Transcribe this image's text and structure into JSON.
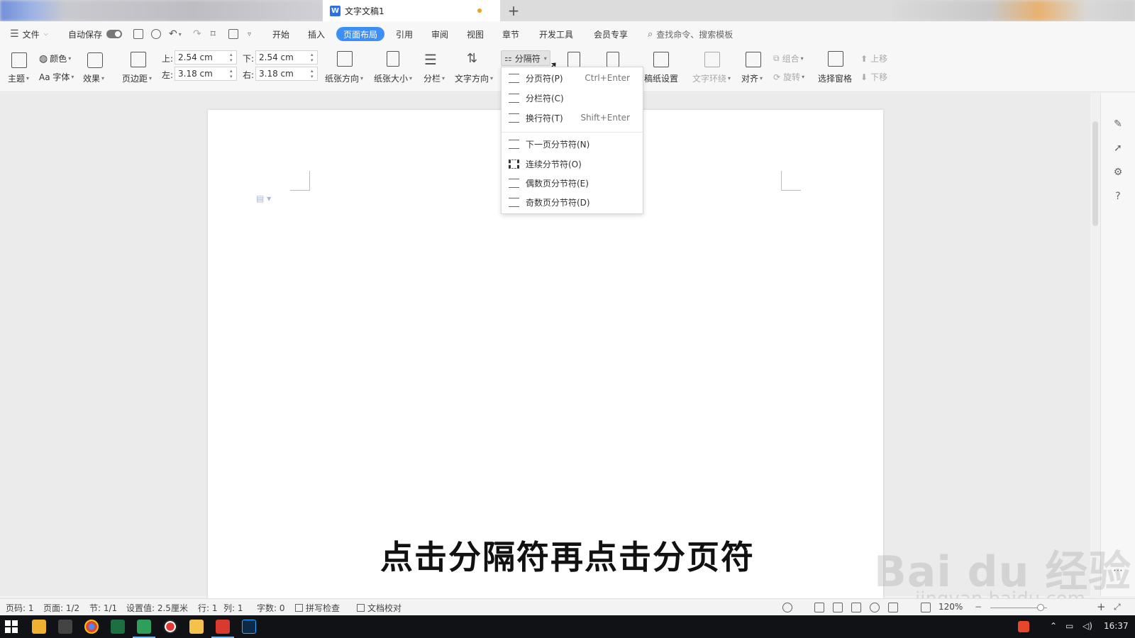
{
  "tab": {
    "title": "文字文稿1",
    "new_tab": "+"
  },
  "menu": {
    "file": "文件",
    "autosave": "自动保存",
    "tabs": [
      "开始",
      "插入",
      "页面布局",
      "引用",
      "审阅",
      "视图",
      "章节",
      "开发工具",
      "会员专享"
    ],
    "active_tab": "页面布局",
    "search_placeholder": "查找命令、搜索模板"
  },
  "ribbon": {
    "theme": "主题",
    "color": "颜色",
    "font": "Aa 字体",
    "effect": "效果",
    "margins": "页边距",
    "margin_top_label": "上:",
    "margin_top": "2.54 cm",
    "margin_bottom_label": "下:",
    "margin_bottom": "2.54 cm",
    "margin_left_label": "左:",
    "margin_left": "3.18 cm",
    "margin_right_label": "右:",
    "margin_right": "3.18 cm",
    "orientation": "纸张方向",
    "size": "纸张大小",
    "columns": "分栏",
    "text_direction": "文字方向",
    "breaks": "分隔符",
    "paper_setup": "稿纸设置",
    "wrap_text": "文字环绕",
    "align": "对齐",
    "group": "组合",
    "rotate": "旋转",
    "selection_pane": "选择窗格",
    "bring_forward": "上移",
    "send_backward": "下移"
  },
  "dropdown": {
    "items": [
      {
        "label": "分页符(P)",
        "shortcut": "Ctrl+Enter"
      },
      {
        "label": "分栏符(C)",
        "shortcut": ""
      },
      {
        "label": "换行符(T)",
        "shortcut": "Shift+Enter"
      },
      {
        "label": "下一页分节符(N)",
        "shortcut": ""
      },
      {
        "label": "连续分节符(O)",
        "shortcut": ""
      },
      {
        "label": "偶数页分节符(E)",
        "shortcut": ""
      },
      {
        "label": "奇数页分节符(D)",
        "shortcut": ""
      }
    ]
  },
  "subtitle": "点击分隔符再点击分页符",
  "watermark": {
    "logo": "Bai du 经验",
    "url": "jingyan.baidu.com"
  },
  "statusbar": {
    "page_num": "页码: 1",
    "pages": "页面: 1/2",
    "section": "节: 1/1",
    "setting": "设置值: 2.5厘米",
    "row": "行: 1",
    "col": "列: 1",
    "words": "字数: 0",
    "spell_check": "拼写检查",
    "doc_proof": "文档校对",
    "zoom": "120%"
  },
  "taskbar": {
    "time": "16:37"
  },
  "colors": {
    "accent": "#3d8ff5",
    "wps_red": "#d83a2e"
  }
}
